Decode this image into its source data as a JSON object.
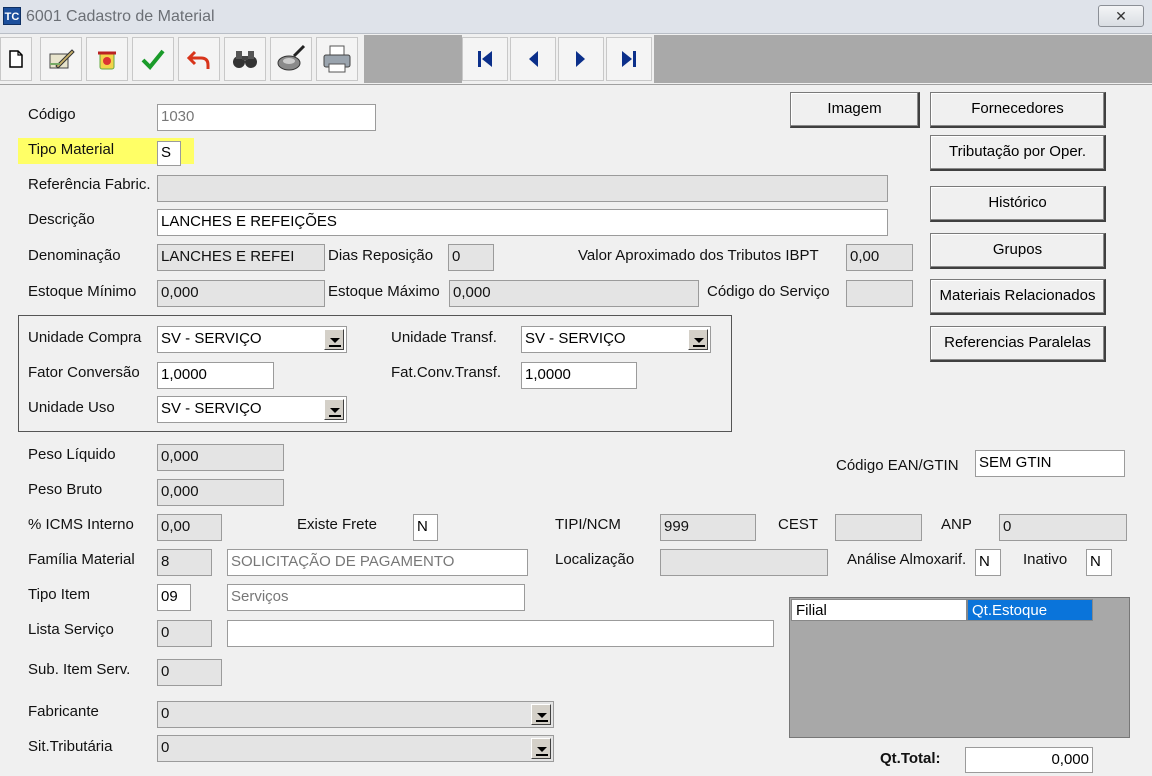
{
  "window": {
    "title": "6001 Cadastro de Material",
    "close_icon": "close-icon"
  },
  "toolbar": {
    "icons": [
      "new-document-icon",
      "edit-icon",
      "delete-icon",
      "confirm-check-icon",
      "undo-icon",
      "search-binoculars-icon",
      "filter-icon",
      "print-icon"
    ],
    "nav": [
      "first-record-icon",
      "previous-record-icon",
      "next-record-icon",
      "last-record-icon"
    ]
  },
  "labels": {
    "codigo": "Código",
    "tipo_material": "Tipo Material",
    "referencia_fabric": "Referência Fabric.",
    "descricao": "Descrição",
    "denominacao": "Denominação",
    "dias_reposicao": "Dias Reposição",
    "valor_aprox": "Valor Aproximado dos Tributos IBPT",
    "estoque_minimo": "Estoque Mínimo",
    "estoque_maximo": "Estoque Máximo",
    "codigo_servico": "Código do Serviço",
    "unidade_compra": "Unidade Compra",
    "unidade_transf": "Unidade Transf.",
    "fator_conversao": "Fator Conversão",
    "fat_conv_transf": "Fat.Conv.Transf.",
    "unidade_uso": "Unidade Uso",
    "peso_liquido": "Peso Líquido",
    "peso_bruto": "Peso Bruto",
    "codigo_ean": "Código EAN/GTIN",
    "icms_interno": "% ICMS Interno",
    "existe_frete": "Existe Frete",
    "tipi_ncm": "TIPI/NCM",
    "cest": "CEST",
    "anp": "ANP",
    "familia_material": "Família Material",
    "localizacao": "Localização",
    "analise_almoxarif": "Análise Almoxarif.",
    "inativo": "Inativo",
    "tipo_item": "Tipo Item",
    "lista_servico": "Lista Serviço",
    "sub_item_serv": "Sub. Item Serv.",
    "fabricante": "Fabricante",
    "sit_tributaria": "Sit.Tributária",
    "qt_total": "Qt.Total:"
  },
  "values": {
    "codigo": "1030",
    "tipo_material": "S",
    "referencia_fabric": "",
    "descricao": "LANCHES E REFEIÇÕES",
    "denominacao": "LANCHES E REFEI",
    "dias_reposicao": "0",
    "valor_aprox": "0,00",
    "estoque_minimo": "0,000",
    "estoque_maximo": "0,000",
    "codigo_servico": "",
    "unidade_compra": "SV - SERVIÇO",
    "unidade_transf": "SV - SERVIÇO",
    "fator_conversao": "1,0000",
    "fat_conv_transf": "1,0000",
    "unidade_uso": "SV - SERVIÇO",
    "peso_liquido": "0,000",
    "peso_bruto": "0,000",
    "codigo_ean": "SEM GTIN",
    "icms_interno": "0,00",
    "existe_frete": "N",
    "tipi_ncm": "999",
    "cest": "",
    "anp": "0",
    "familia_codigo": "8",
    "familia_desc": "SOLICITAÇÃO DE PAGAMENTO",
    "localizacao": "",
    "analise_almoxarif": "N",
    "inativo": "N",
    "tipo_item_codigo": "09",
    "tipo_item_desc": "Serviços",
    "lista_servico_codigo": "0",
    "lista_servico_desc": "",
    "sub_item_serv": "0",
    "fabricante": "0",
    "sit_tributaria": "0",
    "qt_total": "0,000"
  },
  "buttons": {
    "imagem": "Imagem",
    "fornecedores": "Fornecedores",
    "tributacao": "Tributação por Oper.",
    "historico": "Histórico",
    "grupos": "Grupos",
    "materiais_relacionados": "Materiais Relacionados",
    "referencias_paralelas": "Referencias Paralelas"
  },
  "grid": {
    "columns": [
      "Filial",
      "Qt.Estoque"
    ],
    "rows": []
  },
  "colors": {
    "highlight": "#ffff66",
    "selected_header": "#0a74da"
  }
}
